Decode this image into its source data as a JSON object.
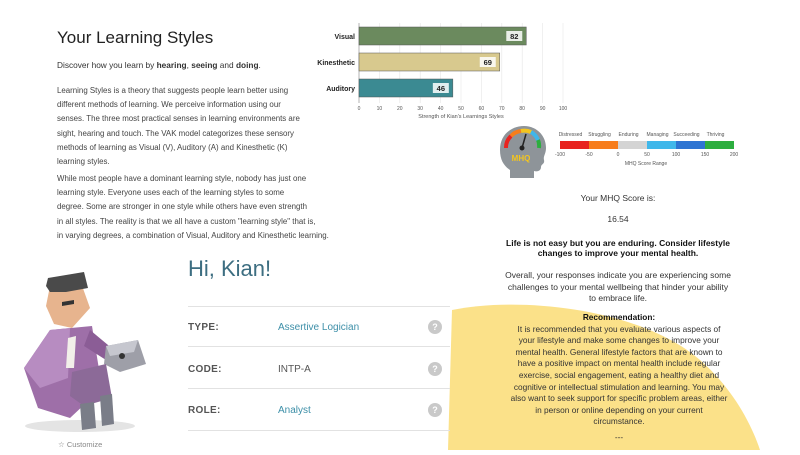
{
  "learning_styles": {
    "title": "Your Learning Styles",
    "intro_pre": "Discover how you learn by ",
    "intro_b1": "hearing",
    "intro_sep1": ", ",
    "intro_b2": "seeing",
    "intro_sep2": " and ",
    "intro_b3": "doing",
    "intro_end": ".",
    "paragraph1": [
      "Learning Styles is a theory that suggests people learn better using",
      "different methods of learning. We perceive information using our",
      "senses. The three most practical senses in learning environments are",
      "sight, hearing and touch. The VAK model categorizes these sensory",
      "methods of learning as Visual (V), Auditory (A) and Kinesthetic (K)",
      "learning styles."
    ],
    "paragraph2": [
      "While most people have a dominant learning style, nobody has just one",
      "learning style. Everyone uses each of the learning styles to some",
      "degree. Some are stronger in one style while others have even strength",
      "in all styles. The reality is that we all have a custom \"learning style\" that is,",
      "in varying degrees, a combination of Visual, Auditory and Kinesthetic learning."
    ]
  },
  "chart_data": {
    "type": "bar",
    "orientation": "horizontal",
    "categories": [
      "Visual",
      "Kinesthetic",
      "Auditory"
    ],
    "values": [
      82,
      69,
      46
    ],
    "colors": [
      "#6b8a5e",
      "#d8c98e",
      "#3b8a92"
    ],
    "xlabel": "Strength of Kian's Learnings Styles",
    "xlim": [
      0,
      100
    ],
    "xticks": [
      "0",
      "10",
      "20",
      "30",
      "40",
      "50",
      "60",
      "70",
      "80",
      "90",
      "100"
    ],
    "grid": true
  },
  "mhq": {
    "gauge_label": "MHQ",
    "scale_title": "MHQ Score Range",
    "categories": [
      {
        "label": "Distressed",
        "color": "#e8231f"
      },
      {
        "label": "Struggling",
        "color": "#f77d1c"
      },
      {
        "label": "Enduring",
        "color": "#d4d4d4"
      },
      {
        "label": "Managing",
        "color": "#3fb7ea"
      },
      {
        "label": "Succeeding",
        "color": "#2d74d2"
      },
      {
        "label": "Thriving",
        "color": "#2dae3f"
      }
    ],
    "ticks": [
      "-100",
      "-50",
      "0",
      "50",
      "100",
      "150",
      "200"
    ],
    "score_label": "Your MHQ Score is:",
    "score": "16.54",
    "headline_1": "Life is not easy but you are enduring. Consider lifestyle",
    "headline_2": "changes to improve your mental health.",
    "overall_1": "Overall, your responses indicate you are experiencing some",
    "overall_2": "challenges to your mental wellbeing that hinder your ability",
    "overall_3": "to embrace life.",
    "rec_title": "Recommendation:",
    "rec_lines": [
      "It is recommended that you evaluate various aspects of",
      "your lifestyle and make some changes to improve your",
      "mental health. General lifestyle factors that are known to",
      "have a positive impact on mental health include regular",
      "exercise, social engagement, eating a healthy diet and",
      "cognitive or intellectual stimulation and learning. You may",
      "also want to seek support for specific problem areas, either",
      "in person or online depending on your current",
      "circumstance."
    ],
    "rec_end": "---"
  },
  "personality": {
    "greeting": "Hi, Kian!",
    "rows": [
      {
        "key": "TYPE:",
        "value": "Assertive Logician",
        "value_color": "#3d8fa8"
      },
      {
        "key": "CODE:",
        "value": "INTP-A",
        "value_color": "#555555"
      },
      {
        "key": "ROLE:",
        "value": "Analyst",
        "value_color": "#3d8fa8"
      }
    ],
    "help_glyph": "?",
    "customize_label": "Customize"
  },
  "colors": {
    "accent": "#3d6e81",
    "yellow": "#fbe189"
  }
}
